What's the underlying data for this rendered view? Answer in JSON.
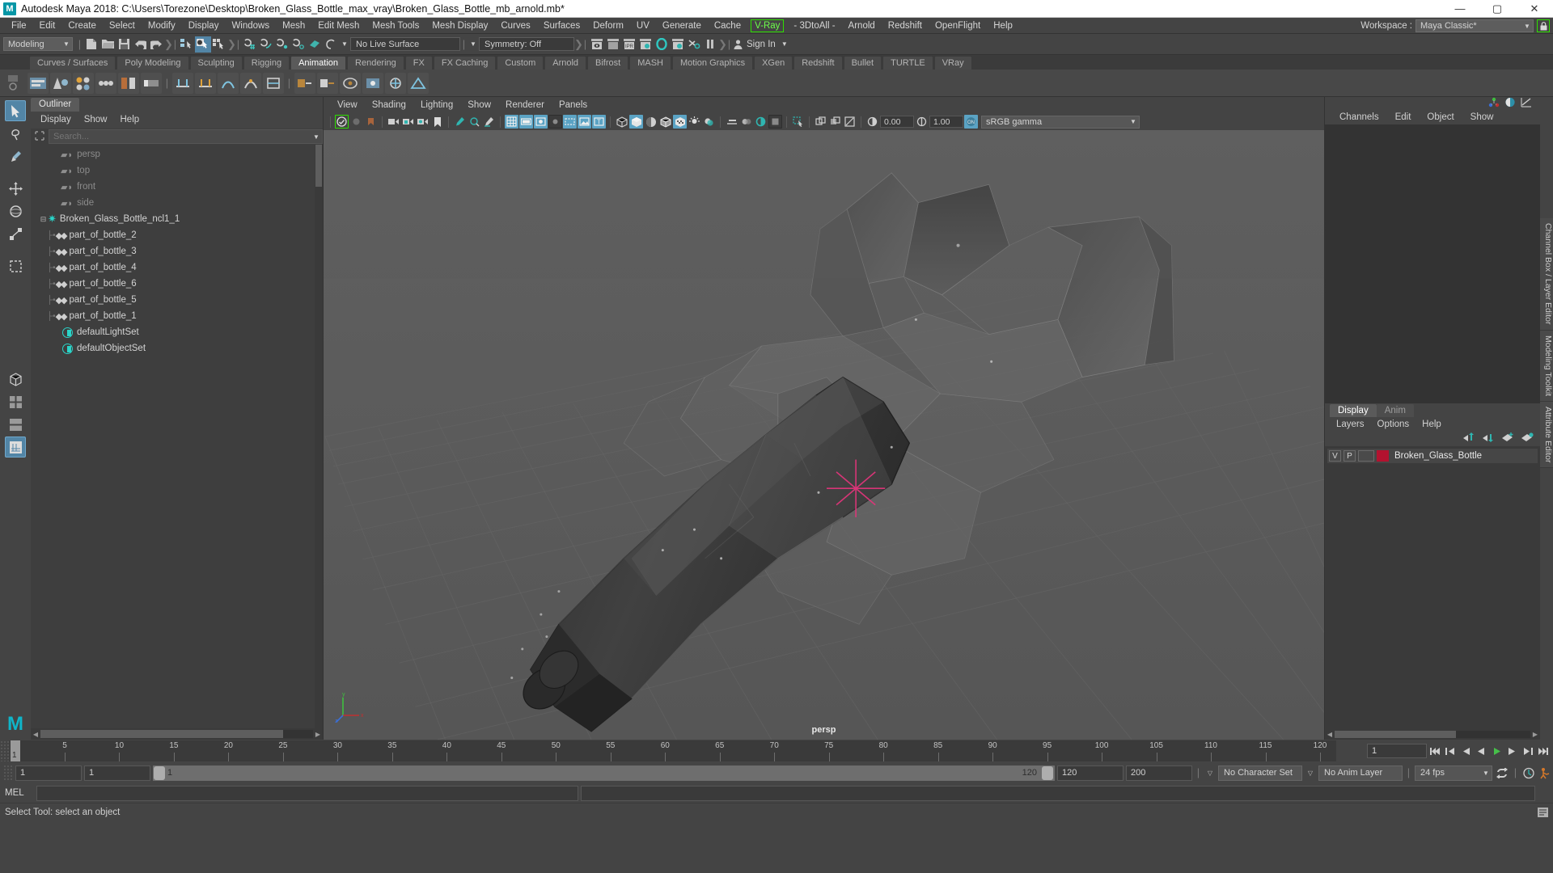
{
  "window": {
    "title": "Autodesk Maya 2018: C:\\Users\\Torezone\\Desktop\\Broken_Glass_Bottle_max_vray\\Broken_Glass_Bottle_mb_arnold.mb*",
    "minimize": "—",
    "maximize": "▢",
    "close": "✕",
    "logo": "M"
  },
  "menubar": {
    "items": [
      {
        "label": "File"
      },
      {
        "label": "Edit"
      },
      {
        "label": "Create"
      },
      {
        "label": "Select"
      },
      {
        "label": "Modify"
      },
      {
        "label": "Display"
      },
      {
        "label": "Windows"
      },
      {
        "label": "Mesh"
      },
      {
        "label": "Edit Mesh"
      },
      {
        "label": "Mesh Tools"
      },
      {
        "label": "Mesh Display"
      },
      {
        "label": "Curves"
      },
      {
        "label": "Surfaces"
      },
      {
        "label": "Deform"
      },
      {
        "label": "UV"
      },
      {
        "label": "Generate"
      },
      {
        "label": "Cache"
      },
      {
        "label": "V-Ray",
        "highlight": true
      },
      {
        "label": "- 3DtoAll -"
      },
      {
        "label": "Arnold"
      },
      {
        "label": "Redshift"
      },
      {
        "label": "OpenFlight"
      },
      {
        "label": "Help"
      }
    ],
    "workspace_label": "Workspace :",
    "workspace_value": "Maya Classic*",
    "lock_icon": "lock-icon",
    "accent_green": "#2ee000"
  },
  "toolbar": {
    "mode": "Modeling",
    "live_surface": "No Live Surface",
    "symmetry": "Symmetry: Off",
    "signin": "Sign In"
  },
  "shelf": {
    "tabs": [
      "Curves / Surfaces",
      "Poly Modeling",
      "Sculpting",
      "Rigging",
      "Animation",
      "Rendering",
      "FX",
      "FX Caching",
      "Custom",
      "Arnold",
      "Bifrost",
      "MASH",
      "Motion Graphics",
      "XGen",
      "Redshift",
      "Bullet",
      "TURTLE",
      "VRay"
    ],
    "active_tab": "Animation"
  },
  "outliner": {
    "tab": "Outliner",
    "menus": [
      "Display",
      "Show",
      "Help"
    ],
    "search_placeholder": "Search...",
    "search_value": "",
    "items": [
      {
        "label": "persp",
        "icon": "camera-icon",
        "depth": 1,
        "dim": true
      },
      {
        "label": "top",
        "icon": "camera-icon",
        "depth": 1,
        "dim": true
      },
      {
        "label": "front",
        "icon": "camera-icon",
        "depth": 1,
        "dim": true
      },
      {
        "label": "side",
        "icon": "camera-icon",
        "depth": 1,
        "dim": true
      },
      {
        "label": "Broken_Glass_Bottle_ncl1_1",
        "icon": "star-icon",
        "depth": 0,
        "expanded": true
      },
      {
        "label": "part_of_bottle_2",
        "icon": "mesh-icon",
        "depth": 1
      },
      {
        "label": "part_of_bottle_3",
        "icon": "mesh-icon",
        "depth": 1
      },
      {
        "label": "part_of_bottle_4",
        "icon": "mesh-icon",
        "depth": 1
      },
      {
        "label": "part_of_bottle_6",
        "icon": "mesh-icon",
        "depth": 1
      },
      {
        "label": "part_of_bottle_5",
        "icon": "mesh-icon",
        "depth": 1
      },
      {
        "label": "part_of_bottle_1",
        "icon": "mesh-icon",
        "depth": 1
      },
      {
        "label": "defaultLightSet",
        "icon": "set-icon",
        "depth": 1
      },
      {
        "label": "defaultObjectSet",
        "icon": "set-icon",
        "depth": 1
      }
    ]
  },
  "viewport": {
    "menus": [
      "View",
      "Shading",
      "Lighting",
      "Show",
      "Renderer",
      "Panels"
    ],
    "exposure": "0.00",
    "gamma": "1.00",
    "colorspace": "sRGB gamma",
    "camera_label": "persp",
    "axis": {
      "x": "x",
      "y": "y",
      "z": "z"
    }
  },
  "channelbox": {
    "menus": [
      "Channels",
      "Edit",
      "Object",
      "Show"
    ],
    "side_tabs": [
      "Channel Box / Layer Editor",
      "Modeling Toolkit",
      "Attribute Editor"
    ]
  },
  "layer_editor": {
    "tabs": [
      "Display",
      "Anim"
    ],
    "active_tab": "Display",
    "menus": [
      "Layers",
      "Options",
      "Help"
    ],
    "columns": [
      "V",
      "P"
    ],
    "layers": [
      {
        "visible": "V",
        "playback": "P",
        "color": "#b3122f",
        "name": "Broken_Glass_Bottle"
      }
    ]
  },
  "timeline": {
    "current_frame": "1",
    "ticks": [
      5,
      10,
      15,
      20,
      25,
      30,
      35,
      40,
      45,
      50,
      55,
      60,
      65,
      70,
      75,
      80,
      85,
      90,
      95,
      100,
      105,
      110,
      115,
      120
    ],
    "start": 1,
    "end": 120,
    "playback_frame": "1"
  },
  "range": {
    "anim_start": "1",
    "range_start": "1",
    "slider_min": "1",
    "slider_max": "120",
    "range_end": "120",
    "anim_end": "200",
    "character_set": "No Character Set",
    "anim_layer": "No Anim Layer",
    "fps": "24 fps"
  },
  "command": {
    "label": "MEL",
    "input_value": "",
    "status": "Select Tool: select an object"
  }
}
